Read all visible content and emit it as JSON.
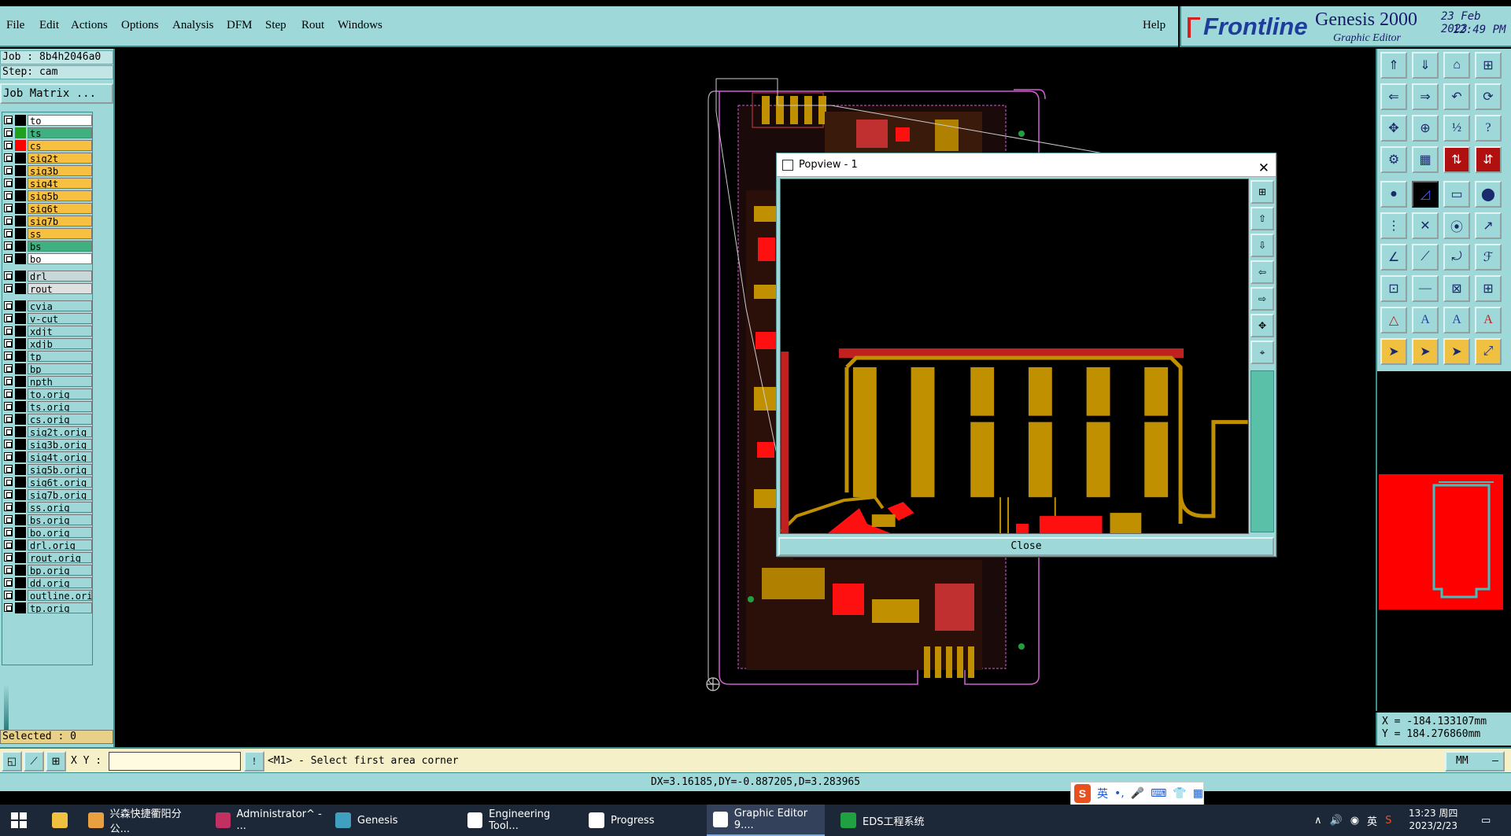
{
  "menu": {
    "file": "File",
    "edit": "Edit",
    "actions": "Actions",
    "options": "Options",
    "analysis": "Analysis",
    "dfm": "DFM",
    "step": "Step",
    "rout": "Rout",
    "windows": "Windows",
    "help": "Help"
  },
  "brand": {
    "logo": "Frontline",
    "product": "Genesis 2000",
    "subtitle": "Graphic Editor",
    "date": "23 Feb 2023",
    "time": "12:49 PM"
  },
  "job": {
    "job_line": "Job : 8b4h2046a0",
    "step_line": "Step: cam",
    "matrix_button": "Job Matrix ..."
  },
  "layers": [
    {
      "name": "to",
      "color": "#ffffff",
      "swatch": "#000000"
    },
    {
      "name": "ts",
      "color": "#40b080",
      "swatch": "#20a020"
    },
    {
      "name": "cs",
      "color": "#f8c040",
      "swatch": "#ff0000"
    },
    {
      "name": "sig2t",
      "color": "#f8c040",
      "swatch": "#000000"
    },
    {
      "name": "sig3b",
      "color": "#f8c040",
      "swatch": "#000000"
    },
    {
      "name": "sig4t",
      "color": "#f8c040",
      "swatch": "#000000"
    },
    {
      "name": "sig5b",
      "color": "#f8c040",
      "swatch": "#000000"
    },
    {
      "name": "sig6t",
      "color": "#f8c040",
      "swatch": "#000000"
    },
    {
      "name": "sig7b",
      "color": "#f8c040",
      "swatch": "#000000"
    },
    {
      "name": "ss",
      "color": "#f8c040",
      "swatch": "#000000"
    },
    {
      "name": "bs",
      "color": "#40b080",
      "swatch": "#000000"
    },
    {
      "name": "bo",
      "color": "#ffffff",
      "swatch": "#000000"
    },
    {
      "name": "drl",
      "color": "#c8d8d8",
      "swatch": "#000000"
    },
    {
      "name": "rout",
      "color": "#e0e0e0",
      "swatch": "#000000"
    },
    {
      "name": "cvia",
      "color": "#9ed8d8",
      "swatch": "#000000"
    },
    {
      "name": "v-cut",
      "color": "#9ed8d8",
      "swatch": "#000000"
    },
    {
      "name": "xdjt",
      "color": "#9ed8d8",
      "swatch": "#000000"
    },
    {
      "name": "xdjb",
      "color": "#9ed8d8",
      "swatch": "#000000"
    },
    {
      "name": "tp",
      "color": "#9ed8d8",
      "swatch": "#000000"
    },
    {
      "name": "bp",
      "color": "#9ed8d8",
      "swatch": "#000000"
    },
    {
      "name": "npth",
      "color": "#9ed8d8",
      "swatch": "#000000"
    },
    {
      "name": "to.orig",
      "color": "#9ed8d8",
      "swatch": "#000000"
    },
    {
      "name": "ts.orig",
      "color": "#9ed8d8",
      "swatch": "#000000"
    },
    {
      "name": "cs.orig",
      "color": "#9ed8d8",
      "swatch": "#000000"
    },
    {
      "name": "sig2t.orig",
      "color": "#9ed8d8",
      "swatch": "#000000"
    },
    {
      "name": "sig3b.orig",
      "color": "#9ed8d8",
      "swatch": "#000000"
    },
    {
      "name": "sig4t.orig",
      "color": "#9ed8d8",
      "swatch": "#000000"
    },
    {
      "name": "sig5b.orig",
      "color": "#9ed8d8",
      "swatch": "#000000"
    },
    {
      "name": "sig6t.orig",
      "color": "#9ed8d8",
      "swatch": "#000000"
    },
    {
      "name": "sig7b.orig",
      "color": "#9ed8d8",
      "swatch": "#000000"
    },
    {
      "name": "ss.orig",
      "color": "#9ed8d8",
      "swatch": "#000000"
    },
    {
      "name": "bs.orig",
      "color": "#9ed8d8",
      "swatch": "#000000"
    },
    {
      "name": "bo.orig",
      "color": "#9ed8d8",
      "swatch": "#000000"
    },
    {
      "name": "drl.orig",
      "color": "#9ed8d8",
      "swatch": "#000000"
    },
    {
      "name": "rout.orig",
      "color": "#9ed8d8",
      "swatch": "#000000"
    },
    {
      "name": "bp.orig",
      "color": "#9ed8d8",
      "swatch": "#000000"
    },
    {
      "name": "dd.orig",
      "color": "#9ed8d8",
      "swatch": "#000000"
    },
    {
      "name": "outline.orig",
      "color": "#9ed8d8",
      "swatch": "#000000"
    },
    {
      "name": "tp.orig",
      "color": "#9ed8d8",
      "swatch": "#000000"
    }
  ],
  "selected": "Selected : 0",
  "popview": {
    "title": "Popview - 1",
    "close_button": "Close"
  },
  "coords": {
    "x_line": "X = -184.133107mm",
    "y_line": "Y = 184.276860mm"
  },
  "command": {
    "xy_label": "X Y :",
    "xy_value": "",
    "prompt": "<M1> - Select first area corner",
    "unit": "MM"
  },
  "measure": "DX=3.16185,DY=-0.887205,D=3.283965",
  "ime": {
    "lang": "英"
  },
  "taskbar": {
    "items": [
      {
        "label": "兴森快捷衢阳分公...",
        "icon_color": "#e8a040"
      },
      {
        "label": "Administrator^ - ...",
        "icon_color": "#c03060"
      },
      {
        "label": "Genesis",
        "icon_color": "#40a0c0"
      },
      {
        "label": "Engineering Tool...",
        "icon_color": "#ffffff"
      },
      {
        "label": "Progress",
        "icon_color": "#ffffff"
      },
      {
        "label": "Graphic Editor 9....",
        "icon_color": "#ffffff"
      },
      {
        "label": "EDS工程系统",
        "icon_color": "#20a040"
      }
    ],
    "tray_lang": "英",
    "clock_time": "13:23 周四",
    "clock_date": "2023/2/23"
  }
}
